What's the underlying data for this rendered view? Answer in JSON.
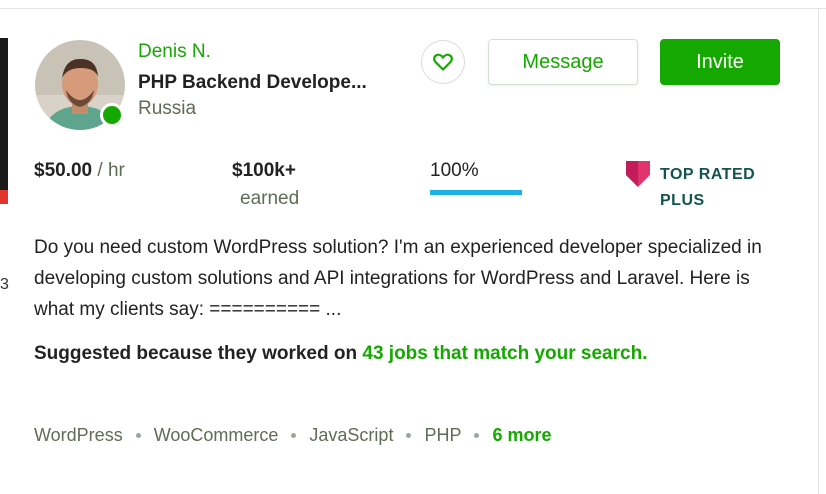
{
  "freelancer": {
    "name": "Denis N.",
    "title": "PHP Backend Develope...",
    "location": "Russia",
    "online": true
  },
  "actions": {
    "favorite_icon": "heart-icon",
    "message_label": "Message",
    "invite_label": "Invite"
  },
  "stats": {
    "rate_amount": "$50.00",
    "rate_unit": " / hr",
    "earned_amount": "$100k+",
    "earned_label": "earned",
    "job_success_text": "100%",
    "job_success_value": 1.0,
    "badge_line1": "TOP RATED",
    "badge_line2": "PLUS"
  },
  "description": "Do you need custom WordPress solution? I'm an experienced developer specialized in developing custom solutions and API integrations for WordPress and Laravel. Here is what my clients say: ========== ...",
  "suggestion": {
    "prefix": "Suggested because they worked on ",
    "link": "43 jobs that match your search."
  },
  "skills": [
    "WordPress",
    "WooCommerce",
    "JavaScript",
    "PHP"
  ],
  "skills_more": "6 more",
  "colors": {
    "accent": "#14a800",
    "job_success_bar": "#1fb1e6",
    "badge": "#e2336e",
    "badge_text": "#13544e"
  }
}
